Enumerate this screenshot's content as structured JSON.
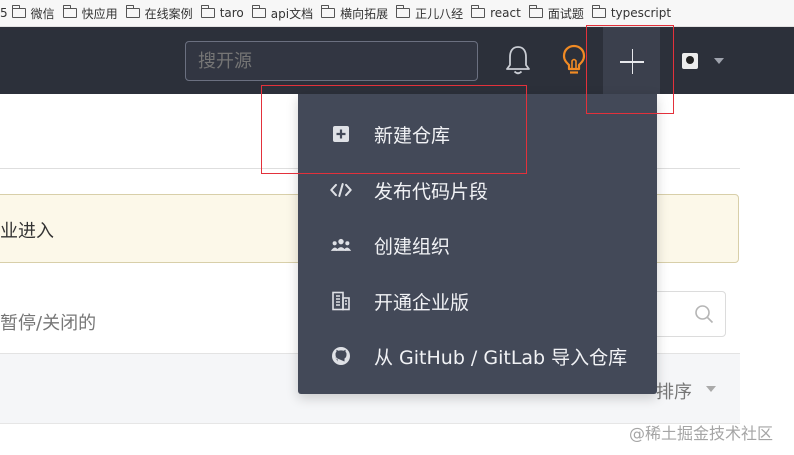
{
  "bookmarks": {
    "leading": "5",
    "items": [
      {
        "label": "微信",
        "icon": "folder-icon"
      },
      {
        "label": "快应用",
        "icon": "folder-icon"
      },
      {
        "label": "在线案例",
        "icon": "folder-icon"
      },
      {
        "label": "taro",
        "icon": "folder-icon"
      },
      {
        "label": "api文档",
        "icon": "folder-icon"
      },
      {
        "label": "横向拓展",
        "icon": "folder-icon"
      },
      {
        "label": "正儿八经",
        "icon": "folder-icon"
      },
      {
        "label": "react",
        "icon": "folder-icon"
      },
      {
        "label": "面试题",
        "icon": "folder-icon"
      },
      {
        "label": "typescript",
        "icon": "folder-icon"
      }
    ]
  },
  "header": {
    "search_placeholder": "搜开源",
    "icons": [
      "bell-icon",
      "lightbulb-icon",
      "plus-icon",
      "avatar",
      "caret-down-icon"
    ],
    "bulb_color": "#f08a24",
    "background": "#2c303a"
  },
  "dropdown": {
    "background": "#434958",
    "items": [
      {
        "label": "新建仓库",
        "icon": "plus-square-icon"
      },
      {
        "label": "发布代码片段",
        "icon": "code-icon"
      },
      {
        "label": "创建组织",
        "icon": "users-icon"
      },
      {
        "label": "开通企业版",
        "icon": "building-icon"
      },
      {
        "label": "从 GitHub / GitLab 导入仓库",
        "icon": "github-icon"
      }
    ]
  },
  "page": {
    "notice_text": "业进入",
    "filter_text": "暂停/关闭的",
    "sort_label": "排序"
  },
  "watermark": "@稀土掘金技术社区",
  "annotation_color": "#e3313b"
}
